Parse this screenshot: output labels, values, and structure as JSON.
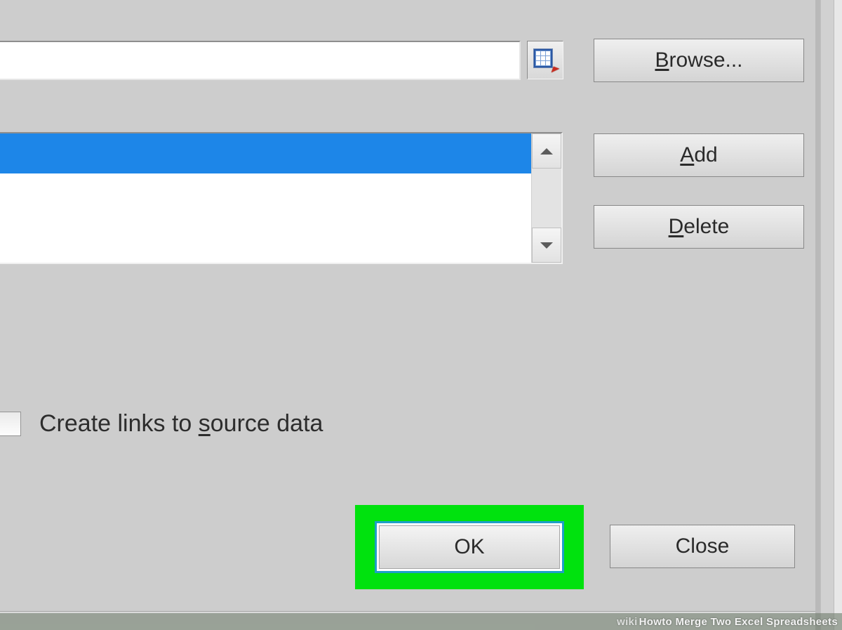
{
  "buttons": {
    "browse_prefix": "B",
    "browse_rest": "rowse...",
    "add_prefix": "A",
    "add_rest": "dd",
    "delete_prefix": "D",
    "delete_rest": "elete",
    "ok": "OK",
    "close": "Close"
  },
  "checkbox": {
    "label_before": "Create links to ",
    "label_ul": "s",
    "label_after": "ource data",
    "checked": false
  },
  "reference_input": {
    "value": ""
  },
  "listbox": {
    "items": [
      {
        "selected": true
      }
    ]
  },
  "watermark": {
    "brand": "wiki",
    "how": "How ",
    "rest": "to Merge Two Excel Spreadsheets"
  }
}
